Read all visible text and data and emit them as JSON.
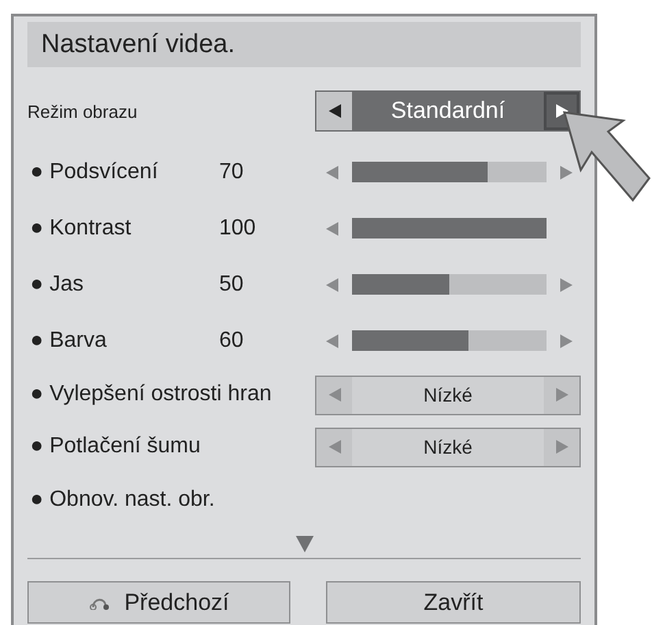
{
  "title": "Nastavení videa.",
  "rows": [
    {
      "kind": "select",
      "label": "Režim obrazu",
      "value": "Standardní",
      "large": true,
      "right_selected": true
    },
    {
      "kind": "slider",
      "label": "● Podsvícení",
      "reading": "70",
      "level": 0.7,
      "can_increase": true
    },
    {
      "kind": "slider",
      "label": "● Kontrast",
      "reading": "100",
      "level": 1,
      "can_increase": false
    },
    {
      "kind": "slider",
      "label": "● Jas",
      "reading": "50",
      "level": 0.5,
      "can_increase": true
    },
    {
      "kind": "slider",
      "label": "● Barva",
      "reading": "60",
      "level": 0.6,
      "can_increase": true
    },
    {
      "kind": "select",
      "label": "● Vylepšení ostrosti hran",
      "value": "Nízké",
      "large": false,
      "right_selected": false
    },
    {
      "kind": "select",
      "label": "● Potlačení šumu",
      "value": "Nízké",
      "large": false,
      "right_selected": false
    },
    {
      "kind": "action",
      "label": "● Obnov. nast. obr."
    }
  ],
  "buttons": [
    {
      "label": "Předchozí",
      "kind": "back"
    },
    {
      "label": "Zavřít",
      "kind": "plain"
    }
  ]
}
